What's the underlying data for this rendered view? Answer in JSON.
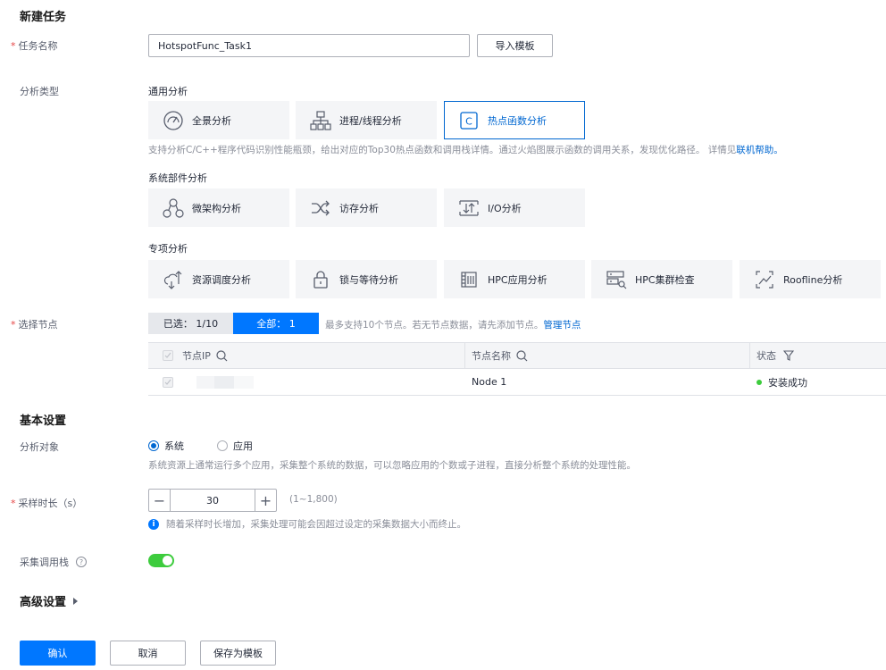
{
  "page_title": "新建任务",
  "task_name": {
    "label": "任务名称",
    "value": "HotspotFunc_Task1",
    "import_button": "导入模板"
  },
  "analysis_type": {
    "label": "分析类型",
    "general": {
      "title": "通用分析",
      "cards": [
        {
          "label": "全景分析",
          "icon": "gauge-icon"
        },
        {
          "label": "进程/线程分析",
          "icon": "process-tree-icon"
        },
        {
          "label": "热点函数分析",
          "icon": "c-code-icon",
          "selected": true
        }
      ],
      "desc": "支持分析C/C++程序代码识别性能瓶颈，给出对应的Top30热点函数和调用栈详情。通过火焰图展示函数的调用关系，发现优化路径。 详情见",
      "help_link": "联机帮助。"
    },
    "system": {
      "title": "系统部件分析",
      "cards": [
        {
          "label": "微架构分析",
          "icon": "microarch-icon"
        },
        {
          "label": "访存分析",
          "icon": "shuffle-icon"
        },
        {
          "label": "I/O分析",
          "icon": "io-icon"
        }
      ]
    },
    "special": {
      "title": "专项分析",
      "cards": [
        {
          "label": "资源调度分析",
          "icon": "resource-schedule-icon"
        },
        {
          "label": "锁与等待分析",
          "icon": "lock-icon"
        },
        {
          "label": "HPC应用分析",
          "icon": "hpc-app-icon"
        },
        {
          "label": "HPC集群检查",
          "icon": "hpc-cluster-icon"
        },
        {
          "label": "Roofline分析",
          "icon": "roofline-icon"
        }
      ]
    }
  },
  "nodes": {
    "label": "选择节点",
    "tab_selected": "已选： 1/10",
    "tab_all": "全部： 1",
    "hint": "最多支持10个节点。若无节点数据，请先添加节点。",
    "manage_link": "管理节点",
    "columns": [
      "节点IP",
      "节点名称",
      "状态"
    ],
    "rows": [
      {
        "ip": "",
        "name": "Node 1",
        "status": "安装成功"
      }
    ]
  },
  "basic_settings": {
    "title": "基本设置",
    "target_label": "分析对象",
    "options": [
      "系统",
      "应用"
    ],
    "target_desc": "系统资源上通常运行多个应用，采集整个系统的数据，可以忽略应用的个数或子进程，直接分析整个系统的处理性能。",
    "duration_label": "采样时长（s）",
    "duration_value": "30",
    "duration_range": "(1~1,800)",
    "duration_note": "随着采样时长增加，采集处理可能会因超过设定的采集数据大小而终止。",
    "callstack_label": "采集调用栈"
  },
  "advanced_settings": {
    "title": "高级设置"
  },
  "footer": {
    "confirm": "确认",
    "cancel": "取消",
    "save_template": "保存为模板"
  },
  "colors": {
    "primary": "#0077ff",
    "link": "#0067d1",
    "required": "#e54545",
    "success": "#3dcc3d"
  }
}
